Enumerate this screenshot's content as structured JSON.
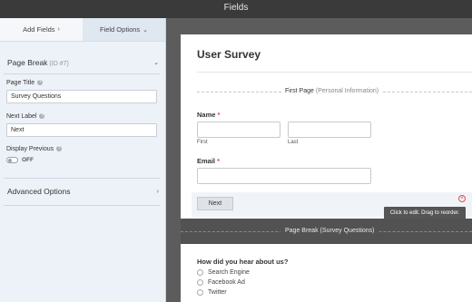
{
  "header": {
    "title": "Fields"
  },
  "tabs": [
    {
      "label": "Add Fields",
      "icon": "chevron-right-icon"
    },
    {
      "label": "Field Options",
      "icon": "chevron-down-icon"
    }
  ],
  "field_options": {
    "section_title": "Page Break",
    "section_id": "(ID #7)",
    "page_title_label": "Page Title",
    "page_title_value": "Survey Questions",
    "next_label_label": "Next Label",
    "next_label_value": "Next",
    "display_previous_label": "Display Previous",
    "display_previous_state": "OFF",
    "display_previous_on": false,
    "advanced_label": "Advanced Options"
  },
  "form": {
    "title": "User Survey",
    "first_page": {
      "label": "First Page",
      "sub": "(Personal Information)"
    },
    "name": {
      "label": "Name",
      "required": "*",
      "first_label": "First",
      "last_label": "Last"
    },
    "email": {
      "label": "Email",
      "required": "*"
    },
    "next_button": "Next",
    "tooltip": "Click to edit. Drag to reorder.",
    "page_break": {
      "label": "Page Break",
      "sub": "(Survey Questions)"
    },
    "question": {
      "label": "How did you hear about us?",
      "options": [
        "Search Engine",
        "Facebook Ad",
        "Twitter"
      ]
    }
  },
  "colors": {
    "sidebar_bg": "#edf2f8",
    "topbar_bg": "#3a3a3a",
    "preview_bg": "#5c5c5c",
    "required": "#e04646"
  }
}
